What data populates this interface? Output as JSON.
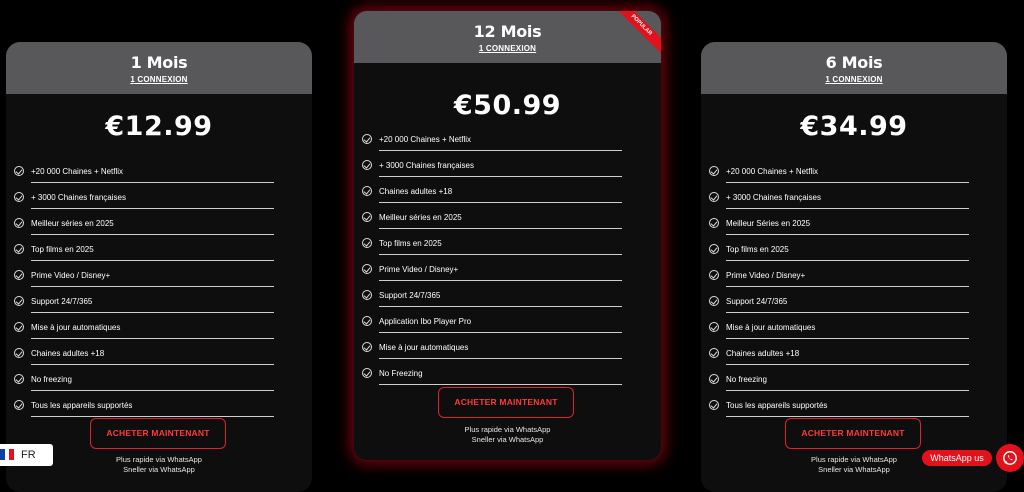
{
  "plans": [
    {
      "title": "1 Mois",
      "connections": "1 CONNEXION",
      "price": "€12.99",
      "features": [
        "+20 000 Chaines + Netflix",
        "+ 3000 Chaines françaises",
        "Meilleur séries en 2025",
        "Top films en 2025",
        "Prime Video / Disney+",
        "Support 24/7/365",
        "Mise à jour automatiques",
        "Chaines adultes +18",
        "No freezing",
        "Tous les appareils supportés"
      ],
      "button": "ACHETER MAINTENANT",
      "note_line1": "Plus rapide via WhatsApp",
      "note_line2": "Sneller via WhatsApp"
    },
    {
      "title": "12 Mois",
      "connections": "1 CONNEXION",
      "price": "€50.99",
      "badge": "POPULAR",
      "features": [
        "+20 000 Chaines + Netflix",
        "+ 3000 Chaines françaises",
        "Chaines adultes +18",
        "Meilleur séries en 2025",
        "Top films en 2025",
        "Prime Video / Disney+",
        "Support 24/7/365",
        "Application Ibo Player Pro",
        "Mise à jour automatiques",
        "No Freezing"
      ],
      "button": "ACHETER MAINTENANT",
      "note_line1": "Plus rapide via WhatsApp",
      "note_line2": "Sneller via WhatsApp"
    },
    {
      "title": "6 Mois",
      "connections": "1 CONNEXION",
      "price": "€34.99",
      "features": [
        "+20 000 Chaines + Netflix",
        "+ 3000 Chaines françaises",
        "Meilleur Séries en 2025",
        "Top films en 2025",
        "Prime Video / Disney+",
        "Support 24/7/365",
        "Mise à jour automatiques",
        "Chaines adultes +18",
        "No freezing",
        "Tous les appareils supportés"
      ],
      "button": "ACHETER MAINTENANT",
      "note_line1": "Plus rapide via WhatsApp",
      "note_line2": "Sneller via WhatsApp"
    }
  ],
  "language": {
    "code": "FR",
    "icon": "france-flag-icon"
  },
  "whatsapp": {
    "label": "WhatsApp us",
    "icon": "whatsapp-icon"
  },
  "colors": {
    "accent": "#e2111b",
    "card_bg": "#0e0e0f",
    "header_bg": "#58585a",
    "page_bg": "#000000"
  }
}
